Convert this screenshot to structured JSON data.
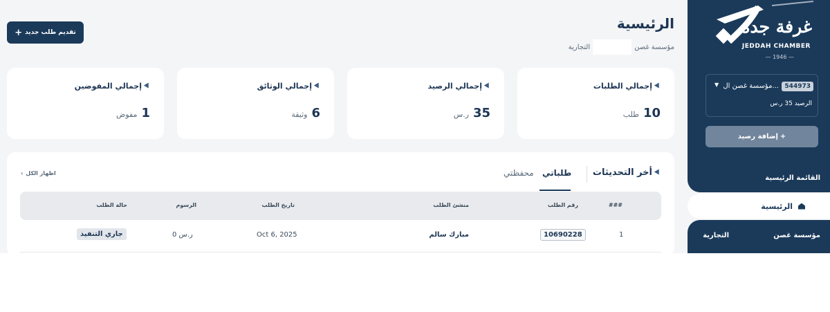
{
  "header": {
    "title": "الرئيسية",
    "org_name_part1": "مؤسسة غصن",
    "org_name_part2": "التجارية",
    "new_request_label": "تقديم طلب جديد",
    "new_request_icon": "plus-icon"
  },
  "sidebar": {
    "logo": {
      "arabic": "غرفة جدة",
      "english": "JEDDAH CHAMBER",
      "year": "— 1946 —"
    },
    "account": {
      "id": "544973",
      "name": "مؤسسة غصن ال...",
      "balance": "الرصيد 35 ر.س"
    },
    "add_balance_label": "إضافة رصيد",
    "menu_title": "القائمة الرئيسية",
    "home_label": "الرئيسية",
    "org_first": "مؤسسة غصن",
    "org_second": "التجارية"
  },
  "stats": [
    {
      "label": "إجمالي الطلبات",
      "value": "10",
      "unit": "طلب"
    },
    {
      "label": "إجمالي الرصيد",
      "value": "35",
      "unit": "ر.س"
    },
    {
      "label": "إجمالي الوثائق",
      "value": "6",
      "unit": "وثيقة"
    },
    {
      "label": "إجمالي المفوضين",
      "value": "1",
      "unit": "مفوض"
    }
  ],
  "updates": {
    "title": "أخر التحديثات",
    "tabs": [
      "طلباتي",
      "محفظتي"
    ],
    "active_tab": "طلباتي",
    "show_all": "اظهار الكل",
    "columns": [
      "###",
      "رقم الطلب",
      "منشئ الطلب",
      "تاريخ الطلب",
      "الرسوم",
      "حالة الطلب"
    ],
    "rows": [
      {
        "index": "1",
        "request_no": "10690228",
        "creator": "مبارك سالم",
        "date": "Oct 6, 2025",
        "fee": "0 ر.س",
        "status": "جاري التنفيذ"
      }
    ]
  },
  "colors": {
    "primary": "#1b3a5a",
    "background": "#f4f5f7",
    "card": "#ffffff",
    "button_muted": "#71859c"
  }
}
